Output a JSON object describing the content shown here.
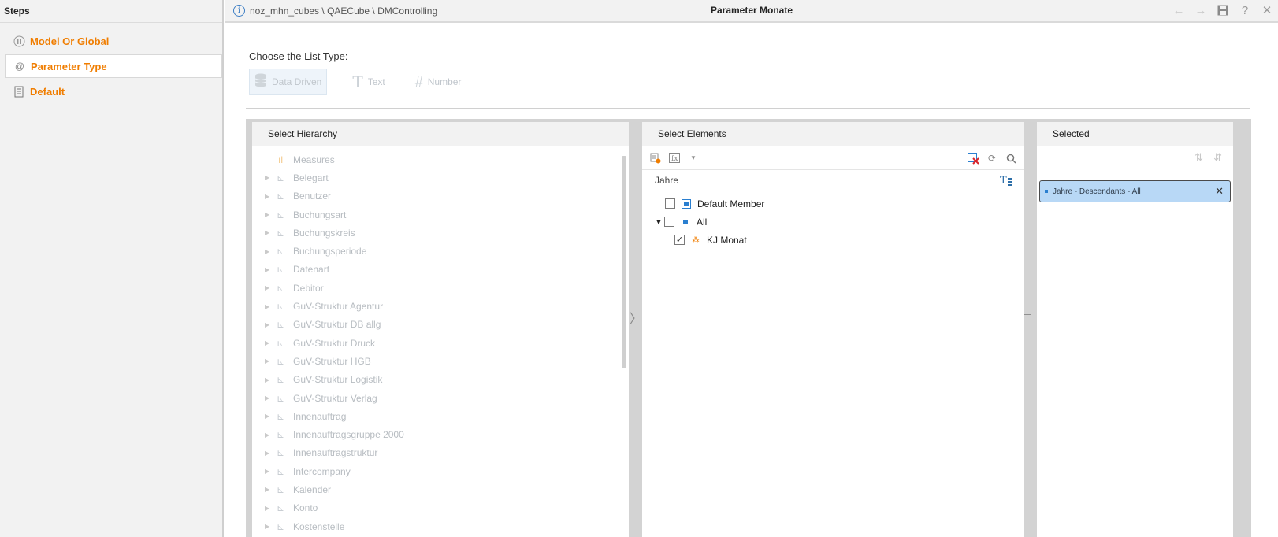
{
  "steps": {
    "header": "Steps",
    "items": [
      {
        "label": "Model Or Global",
        "icon": "model-global-icon"
      },
      {
        "label": "Parameter Type",
        "icon": "at-pencil-icon"
      },
      {
        "label": "Default",
        "icon": "document-icon"
      }
    ]
  },
  "topbar": {
    "breadcrumb": "noz_mhn_cubes \\ QAECube \\ DMControlling",
    "title": "Parameter Monate"
  },
  "list_type": {
    "label": "Choose the List Type:",
    "options": [
      "Data Driven",
      "Text",
      "Number"
    ],
    "selected": "Data Driven"
  },
  "hierarchy": {
    "header": "Select Hierarchy",
    "items": [
      "Measures",
      "Belegart",
      "Benutzer",
      "Buchungsart",
      "Buchungskreis",
      "Buchungsperiode",
      "Datenart",
      "Debitor",
      "GuV-Struktur Agentur",
      "GuV-Struktur DB allg",
      "GuV-Struktur Druck",
      "GuV-Struktur HGB",
      "GuV-Struktur Logistik",
      "GuV-Struktur Verlag",
      "Innenauftrag",
      "Innenauftragsgruppe 2000",
      "Innenauftragstruktur",
      "Intercompany",
      "Kalender",
      "Konto",
      "Kostenstelle"
    ]
  },
  "elements": {
    "header": "Select Elements",
    "hierarchy_name": "Jahre",
    "nodes": [
      {
        "label": "Default Member",
        "checked": false
      },
      {
        "label": "All",
        "checked": false
      },
      {
        "label": "KJ Monat",
        "checked": true
      }
    ]
  },
  "selected": {
    "header": "Selected",
    "chip": "Jahre - Descendants - All"
  },
  "colors": {
    "accent": "#f07d00",
    "chip_bg": "#b8d8f6",
    "member_blue": "#2a7fd0"
  }
}
